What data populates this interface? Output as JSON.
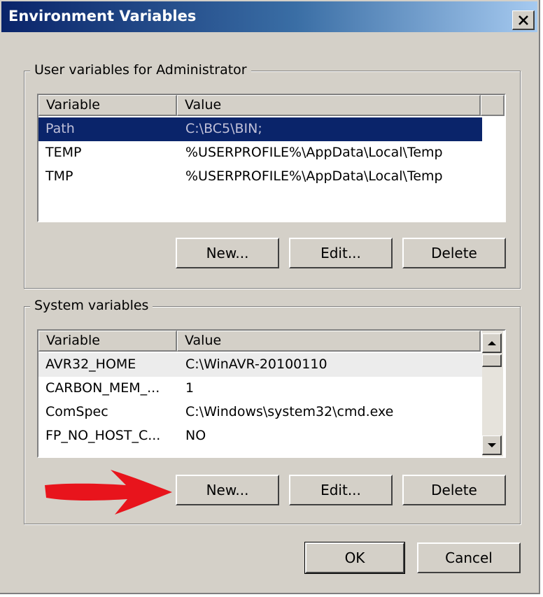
{
  "window": {
    "title": "Environment Variables"
  },
  "user_group": {
    "label": "User variables for Administrator",
    "columns": [
      "Variable",
      "Value"
    ],
    "rows": [
      {
        "variable": "Path",
        "value": "C:\\BC5\\BIN;",
        "selected": true
      },
      {
        "variable": "TEMP",
        "value": "%USERPROFILE%\\AppData\\Local\\Temp"
      },
      {
        "variable": "TMP",
        "value": "%USERPROFILE%\\AppData\\Local\\Temp"
      }
    ],
    "buttons": {
      "new": "New...",
      "edit": "Edit...",
      "delete": "Delete"
    }
  },
  "system_group": {
    "label": "System variables",
    "columns": [
      "Variable",
      "Value"
    ],
    "rows": [
      {
        "variable": "AVR32_HOME",
        "value": "C:\\WinAVR-20100110"
      },
      {
        "variable": "CARBON_MEM_...",
        "value": "1"
      },
      {
        "variable": "ComSpec",
        "value": "C:\\Windows\\system32\\cmd.exe"
      },
      {
        "variable": "FP_NO_HOST_C...",
        "value": "NO"
      }
    ],
    "buttons": {
      "new": "New...",
      "edit": "Edit...",
      "delete": "Delete"
    }
  },
  "footer": {
    "ok": "OK",
    "cancel": "Cancel"
  },
  "icons": {
    "close": "close-icon",
    "scroll_up": "scroll-up-arrow-icon",
    "scroll_down": "scroll-down-arrow-icon",
    "annotation": "red-arrow-annotation-icon"
  },
  "colors": {
    "title_start": "#0a246a",
    "title_end": "#a6caf0",
    "selection": "#0a246a",
    "annotation_arrow": "#e8141c",
    "face": "#d4d0c8"
  }
}
